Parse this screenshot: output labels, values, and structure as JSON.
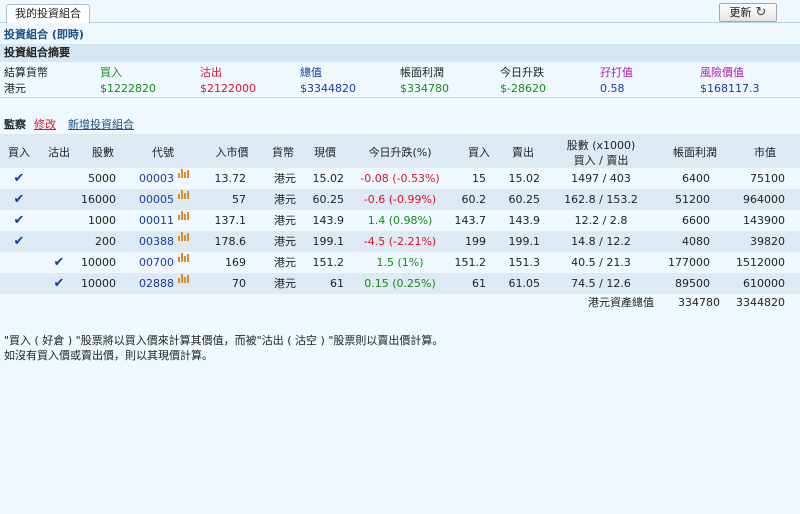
{
  "tab_label": "我的投資組合",
  "refresh_label": "更新",
  "portfolio_title": "投資組合 (即時)",
  "summary": {
    "heading": "投資組合摘要",
    "labels": {
      "currency": "結算貨幣",
      "buy": "買入",
      "sell": "沽出",
      "total": "總值",
      "book_pl": "帳面利潤",
      "today_change": "今日升跌",
      "margin": "孖打值",
      "risk_value": "風險價值"
    },
    "values": {
      "currency": "港元",
      "buy": "$1222820",
      "sell": "$2122000",
      "total": "$3344820",
      "book_pl": "$334780",
      "today_change": "$-28620",
      "margin": "0.58",
      "risk_value": "$168117.3"
    }
  },
  "watch": {
    "label": "監察",
    "modify": "修改",
    "add_portfolio": "新增投資組合"
  },
  "table": {
    "headers": {
      "buy": "買入",
      "sell": "沽出",
      "shares": "股數",
      "code": "代號",
      "entry_price": "入市價",
      "currency": "貨幣",
      "price": "現價",
      "today_change_pct": "今日升跌(%)",
      "bid": "買入",
      "ask": "賣出",
      "volume_line1": "股數 (x1000)",
      "volume_line2": "買入 / 賣出",
      "book_pl": "帳面利潤",
      "market_value": "市值"
    },
    "rows": [
      {
        "buy": "✔",
        "sell": "",
        "shares": "5000",
        "code": "00003",
        "entry": "13.72",
        "currency": "港元",
        "price": "15.02",
        "change": "-0.08 (-0.53%)",
        "dir": "down",
        "bid": "15",
        "ask": "15.02",
        "volume": "1497 / 403",
        "pl": "6400",
        "value": "75100"
      },
      {
        "buy": "✔",
        "sell": "",
        "shares": "16000",
        "code": "00005",
        "entry": "57",
        "currency": "港元",
        "price": "60.25",
        "change": "-0.6 (-0.99%)",
        "dir": "down",
        "bid": "60.2",
        "ask": "60.25",
        "volume": "162.8 / 153.2",
        "pl": "51200",
        "value": "964000"
      },
      {
        "buy": "✔",
        "sell": "",
        "shares": "1000",
        "code": "00011",
        "entry": "137.1",
        "currency": "港元",
        "price": "143.9",
        "change": "1.4 (0.98%)",
        "dir": "up",
        "bid": "143.7",
        "ask": "143.9",
        "volume": "12.2 / 2.8",
        "pl": "6600",
        "value": "143900"
      },
      {
        "buy": "✔",
        "sell": "",
        "shares": "200",
        "code": "00388",
        "entry": "178.6",
        "currency": "港元",
        "price": "199.1",
        "change": "-4.5 (-2.21%)",
        "dir": "down",
        "bid": "199",
        "ask": "199.1",
        "volume": "14.8 / 12.2",
        "pl": "4080",
        "value": "39820"
      },
      {
        "buy": "",
        "sell": "✔",
        "shares": "10000",
        "code": "00700",
        "entry": "169",
        "currency": "港元",
        "price": "151.2",
        "change": "1.5 (1%)",
        "dir": "up",
        "bid": "151.2",
        "ask": "151.3",
        "volume": "40.5 / 21.3",
        "pl": "177000",
        "value": "1512000"
      },
      {
        "buy": "",
        "sell": "✔",
        "shares": "10000",
        "code": "02888",
        "entry": "70",
        "currency": "港元",
        "price": "61",
        "change": "0.15 (0.25%)",
        "dir": "up",
        "bid": "61",
        "ask": "61.05",
        "volume": "74.5 / 12.6",
        "pl": "89500",
        "value": "610000"
      }
    ],
    "totals": {
      "label": "港元資產總值",
      "pl": "334780",
      "value": "3344820"
    }
  },
  "notes": {
    "line1": "\"買入 ( 好倉 ) \"股票將以買入價來計算其價值，而被\"沽出 ( 沽空 ) \"股票則以賣出價計算。",
    "line2": "如沒有買入價或賣出價，則以其現價計算。"
  },
  "colors": {
    "up": "#1a8a1a",
    "down": "#e0102a",
    "link": "#1a3aa8",
    "header_bg": "#dde9f3",
    "page_bg": "#eff8fe"
  }
}
